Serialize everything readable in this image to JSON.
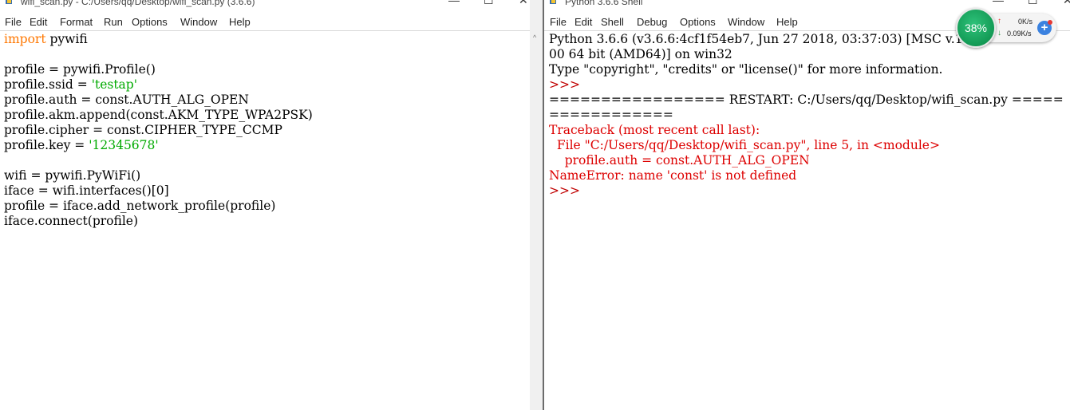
{
  "editor": {
    "title": "wifi_scan.py - C:/Users/qq/Desktop/wifi_scan.py (3.6.6)",
    "menu": [
      "File",
      "Edit",
      "Format",
      "Run",
      "Options",
      "Window",
      "Help"
    ],
    "code_lines": [
      [
        {
          "t": "import",
          "c": "kw"
        },
        {
          "t": " pywifi",
          "c": ""
        }
      ],
      [],
      [
        {
          "t": "profile = pywifi.Profile()",
          "c": ""
        }
      ],
      [
        {
          "t": "profile.ssid = ",
          "c": ""
        },
        {
          "t": "'testap'",
          "c": "str"
        }
      ],
      [
        {
          "t": "profile.auth = const.AUTH_ALG_OPEN",
          "c": ""
        }
      ],
      [
        {
          "t": "profile.akm.append(const.AKM_TYPE_WPA2PSK)",
          "c": ""
        }
      ],
      [
        {
          "t": "profile.cipher = const.CIPHER_TYPE_CCMP",
          "c": ""
        }
      ],
      [
        {
          "t": "profile.key = ",
          "c": ""
        },
        {
          "t": "'12345678'",
          "c": "str"
        }
      ],
      [],
      [
        {
          "t": "wifi = pywifi.PyWiFi()",
          "c": ""
        }
      ],
      [
        {
          "t": "iface = wifi.interfaces()[0]",
          "c": ""
        }
      ],
      [
        {
          "t": "profile = iface.add_network_profile(profile)",
          "c": ""
        }
      ],
      [
        {
          "t": "iface.connect(profile)",
          "c": ""
        }
      ]
    ]
  },
  "shell": {
    "title": "Python 3.6.6 Shell",
    "menu": [
      "File",
      "Edit",
      "Shell",
      "Debug",
      "Options",
      "Window",
      "Help"
    ],
    "lines": [
      [
        {
          "t": "Python 3.6.6 (v3.6.6:4cf1f54eb7, Jun 27 2018, 03:37:03) [MSC v.19",
          "c": ""
        }
      ],
      [
        {
          "t": "00 64 bit (AMD64)] on win32",
          "c": ""
        }
      ],
      [
        {
          "t": "Type \"copyright\", \"credits\" or \"license()\" for more information.",
          "c": ""
        }
      ],
      [
        {
          "t": ">>> ",
          "c": "prompt"
        }
      ],
      [
        {
          "t": "================= RESTART: C:/Users/qq/Desktop/wifi_scan.py =====",
          "c": ""
        }
      ],
      [
        {
          "t": "============",
          "c": ""
        }
      ],
      [
        {
          "t": "Traceback (most recent call last):",
          "c": "err"
        }
      ],
      [
        {
          "t": "  File \"C:/Users/qq/Desktop/wifi_scan.py\", line 5, in <module>",
          "c": "err"
        }
      ],
      [
        {
          "t": "    profile.auth = const.AUTH_ALG_OPEN",
          "c": "err"
        }
      ],
      [
        {
          "t": "NameError: name 'const' is not defined",
          "c": "err"
        }
      ],
      [
        {
          "t": ">>> ",
          "c": "prompt"
        }
      ]
    ]
  },
  "net_widget": {
    "percent": "38%",
    "upload": "0K/s",
    "download": "0.09K/s"
  },
  "colors": {
    "keyword": "#ff7700",
    "string": "#00aa00",
    "error": "#dd0000",
    "prompt": "#c00000"
  }
}
